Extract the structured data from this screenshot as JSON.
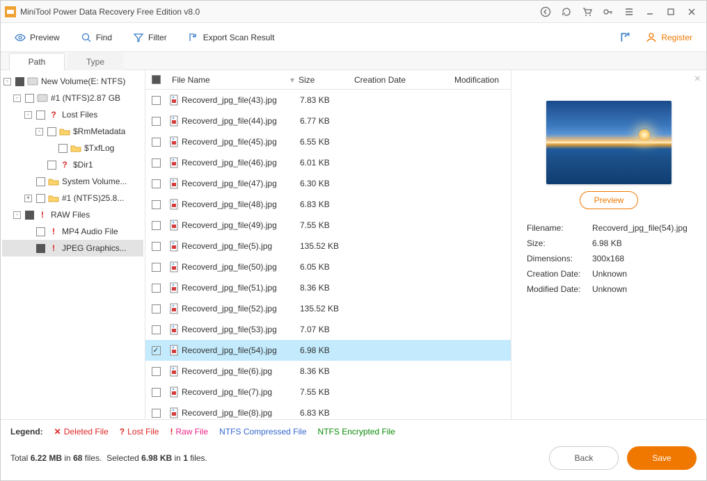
{
  "titlebar": {
    "title": "MiniTool Power Data Recovery Free Edition v8.0"
  },
  "toolbar": {
    "preview": "Preview",
    "find": "Find",
    "filter": "Filter",
    "export": "Export Scan Result",
    "register": "Register"
  },
  "tabs": {
    "path": "Path",
    "type": "Type"
  },
  "tree": {
    "root": "New Volume(E: NTFS)",
    "drive": "#1 (NTFS)2.87 GB",
    "lost": "Lost Files",
    "rm": "$RmMetadata",
    "txf": "$TxfLog",
    "dir1": "$Dir1",
    "sysvol": "System Volume...",
    "drive2": "#1 (NTFS)25.8...",
    "raw": "RAW Files",
    "mp4": "MP4 Audio File",
    "jpeg": "JPEG Graphics..."
  },
  "columns": {
    "name": "File Name",
    "size": "Size",
    "cdate": "Creation Date",
    "mdate": "Modification"
  },
  "files": [
    {
      "name": "Recoverd_jpg_file(43).jpg",
      "size": "7.83 KB"
    },
    {
      "name": "Recoverd_jpg_file(44).jpg",
      "size": "6.77 KB"
    },
    {
      "name": "Recoverd_jpg_file(45).jpg",
      "size": "6.55 KB"
    },
    {
      "name": "Recoverd_jpg_file(46).jpg",
      "size": "6.01 KB"
    },
    {
      "name": "Recoverd_jpg_file(47).jpg",
      "size": "6.30 KB"
    },
    {
      "name": "Recoverd_jpg_file(48).jpg",
      "size": "6.83 KB"
    },
    {
      "name": "Recoverd_jpg_file(49).jpg",
      "size": "7.55 KB"
    },
    {
      "name": "Recoverd_jpg_file(5).jpg",
      "size": "135.52 KB"
    },
    {
      "name": "Recoverd_jpg_file(50).jpg",
      "size": "6.05 KB"
    },
    {
      "name": "Recoverd_jpg_file(51).jpg",
      "size": "8.36 KB"
    },
    {
      "name": "Recoverd_jpg_file(52).jpg",
      "size": "135.52 KB"
    },
    {
      "name": "Recoverd_jpg_file(53).jpg",
      "size": "7.07 KB"
    },
    {
      "name": "Recoverd_jpg_file(54).jpg",
      "size": "6.98 KB",
      "checked": true,
      "selected": true
    },
    {
      "name": "Recoverd_jpg_file(6).jpg",
      "size": "8.36 KB"
    },
    {
      "name": "Recoverd_jpg_file(7).jpg",
      "size": "7.55 KB"
    },
    {
      "name": "Recoverd_jpg_file(8).jpg",
      "size": "6.83 KB"
    }
  ],
  "preview": {
    "button": "Preview",
    "meta": {
      "filename_k": "Filename:",
      "filename_v": "Recoverd_jpg_file(54).jpg",
      "size_k": "Size:",
      "size_v": "6.98 KB",
      "dim_k": "Dimensions:",
      "dim_v": "300x168",
      "cdate_k": "Creation Date:",
      "cdate_v": "Unknown",
      "mdate_k": "Modified Date:",
      "mdate_v": "Unknown"
    }
  },
  "legend": {
    "title": "Legend:",
    "deleted": "Deleted File",
    "lost": "Lost File",
    "raw": "Raw File",
    "ntfscomp": "NTFS Compressed File",
    "ntfsenc": "NTFS Encrypted File"
  },
  "status": {
    "total": "6.22 MB",
    "files": "68",
    "sel_size": "6.98 KB",
    "sel_count": "1"
  },
  "buttons": {
    "back": "Back",
    "save": "Save"
  }
}
